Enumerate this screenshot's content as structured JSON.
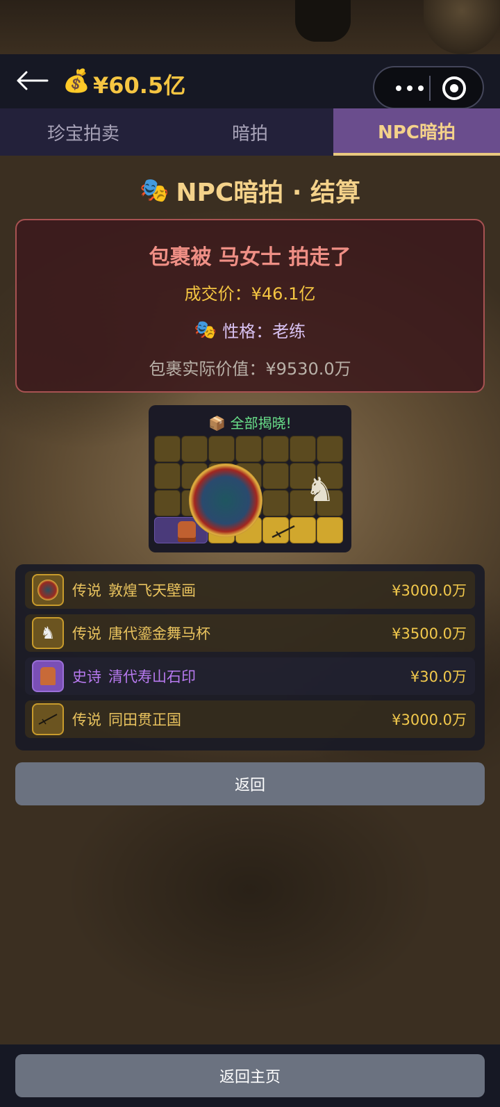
{
  "header": {
    "money_icon": "💰",
    "money": "¥60.5亿"
  },
  "tabs": [
    {
      "label": "珍宝拍卖",
      "active": false
    },
    {
      "label": "暗拍",
      "active": false
    },
    {
      "label": "NPC暗拍",
      "active": true
    }
  ],
  "title": {
    "icon": "🎭",
    "text": "NPC暗拍 · 结算"
  },
  "result": {
    "headline": "包裹被 马女士 拍走了",
    "deal_price": "成交价：¥46.1亿",
    "personality_icon": "🎭",
    "personality": "性格：老练",
    "actual_value": "包裹实际价值：¥9530.0万"
  },
  "reveal": {
    "icon": "📦",
    "label": "全部揭晓!"
  },
  "items": [
    {
      "rarity": "传说",
      "name": "敦煌飞天壁画",
      "price": "¥3000.0万",
      "tier": "legend",
      "icon": "mural-disc-icon"
    },
    {
      "rarity": "传说",
      "name": "唐代鎏金舞马杯",
      "price": "¥3500.0万",
      "tier": "legend",
      "icon": "horse-cup-icon"
    },
    {
      "rarity": "史诗",
      "name": "清代寿山石印",
      "price": "¥30.0万",
      "tier": "epic",
      "icon": "stone-seal-icon"
    },
    {
      "rarity": "传说",
      "name": "同田贯正国",
      "price": "¥3000.0万",
      "tier": "legend",
      "icon": "katana-icon"
    }
  ],
  "buttons": {
    "return": "返回",
    "home": "返回主页"
  },
  "colors": {
    "accent_gold": "#f4d28a",
    "money": "#f5c542",
    "legend": "#e9c35e",
    "epic": "#b87af0",
    "tab_active": "#6a4d8d",
    "result_border": "#a85252"
  }
}
